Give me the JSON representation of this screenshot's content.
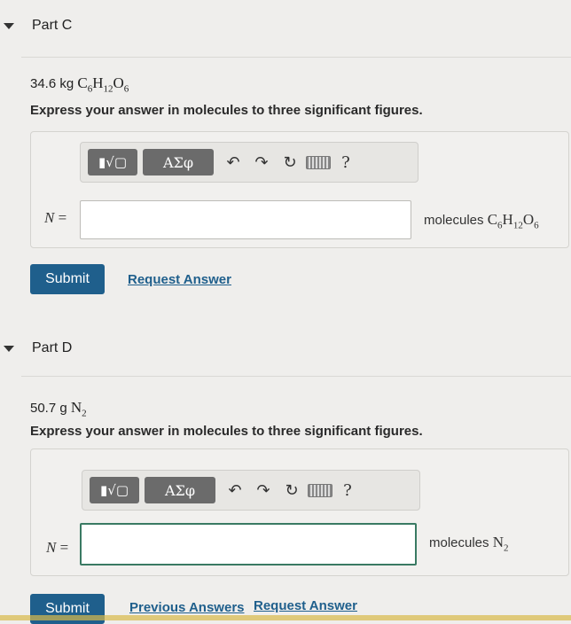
{
  "partC": {
    "title": "Part C",
    "given_amount": "34.6 kg ",
    "given_formula": "C6H12O6",
    "instruction": "Express your answer in molecules to three significant figures.",
    "var_label": "N",
    "eq": " =",
    "units_text": "molecules ",
    "units_formula": "C6H12O6",
    "input_value": "",
    "submit": "Submit",
    "request": "Request Answer"
  },
  "partD": {
    "title": "Part D",
    "given_amount": "50.7 g ",
    "given_formula": "N2",
    "instruction": "Express your answer in molecules to three significant figures.",
    "var_label": "N",
    "eq": " =",
    "units_text": "molecules ",
    "units_formula": "N2",
    "input_value": "",
    "submit": "Submit",
    "previous": "Previous Answers",
    "request": "Request Answer"
  },
  "toolbar": {
    "greek": "ΑΣφ",
    "help": "?"
  },
  "icons": [
    "triangle-down-icon",
    "template-icon",
    "undo-icon",
    "redo-icon",
    "reset-icon",
    "keyboard-icon",
    "help-icon"
  ]
}
